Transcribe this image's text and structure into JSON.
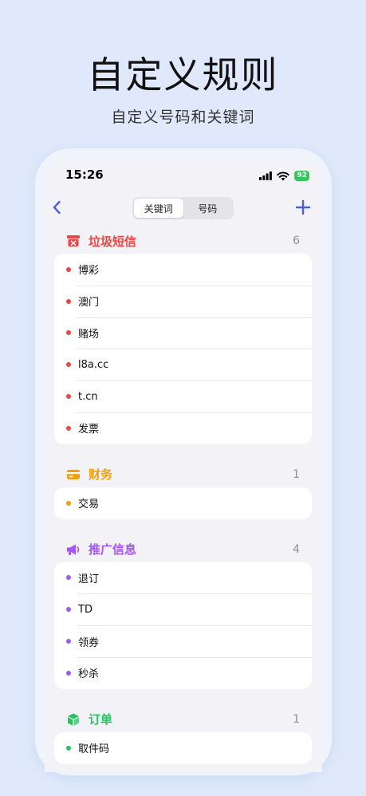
{
  "hero": {
    "title": "自定义规则",
    "subtitle": "自定义号码和关键词"
  },
  "status_bar": {
    "time": "15:26",
    "battery": "92"
  },
  "nav": {
    "tabs": [
      {
        "label": "关键词",
        "active": true
      },
      {
        "label": "号码",
        "active": false
      }
    ]
  },
  "sections": [
    {
      "title": "垃圾短信",
      "count": "6",
      "color": "#ef4444",
      "icon": "spam-box-icon",
      "items": [
        "博彩",
        "澳门",
        "赌场",
        "l8a.cc",
        "t.cn",
        "发票"
      ]
    },
    {
      "title": "财务",
      "count": "1",
      "color": "#f59e0b",
      "icon": "card-icon",
      "items": [
        "交易"
      ]
    },
    {
      "title": "推广信息",
      "count": "4",
      "color": "#a855f7",
      "icon": "megaphone-icon",
      "items": [
        "退订",
        "TD",
        "领券",
        "秒杀"
      ]
    },
    {
      "title": "订单",
      "count": "1",
      "color": "#22c55e",
      "icon": "package-icon",
      "items": [
        "取件码"
      ]
    }
  ],
  "colors": {
    "accent": "#4a5fe0",
    "background": "#dfe9fb"
  }
}
